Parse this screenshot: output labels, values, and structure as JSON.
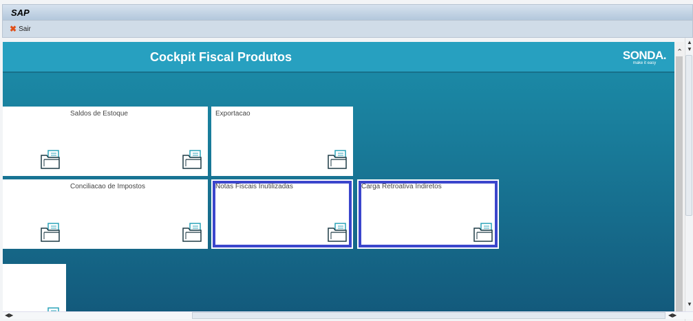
{
  "window": {
    "title": "SAP"
  },
  "toolbar": {
    "exit_label": "Sair"
  },
  "page": {
    "title": "Cockpit Fiscal Produtos",
    "logo_text": "SONDA.",
    "logo_tagline": "make it easy"
  },
  "tiles": [
    {
      "label": ""
    },
    {
      "label": "Saldos de Estoque"
    },
    {
      "label": "Exportacao"
    },
    {
      "label": ""
    },
    {
      "label": "Conciliacao de Impostos"
    },
    {
      "label": "Notas Fiscais Inutilizadas"
    },
    {
      "label": "Carga Retroativa Indiretos"
    },
    {
      "label": ""
    }
  ],
  "colors": {
    "header": "#27a0c0",
    "selected_border": "#3b46cc",
    "exit_icon": "#e0501a"
  }
}
